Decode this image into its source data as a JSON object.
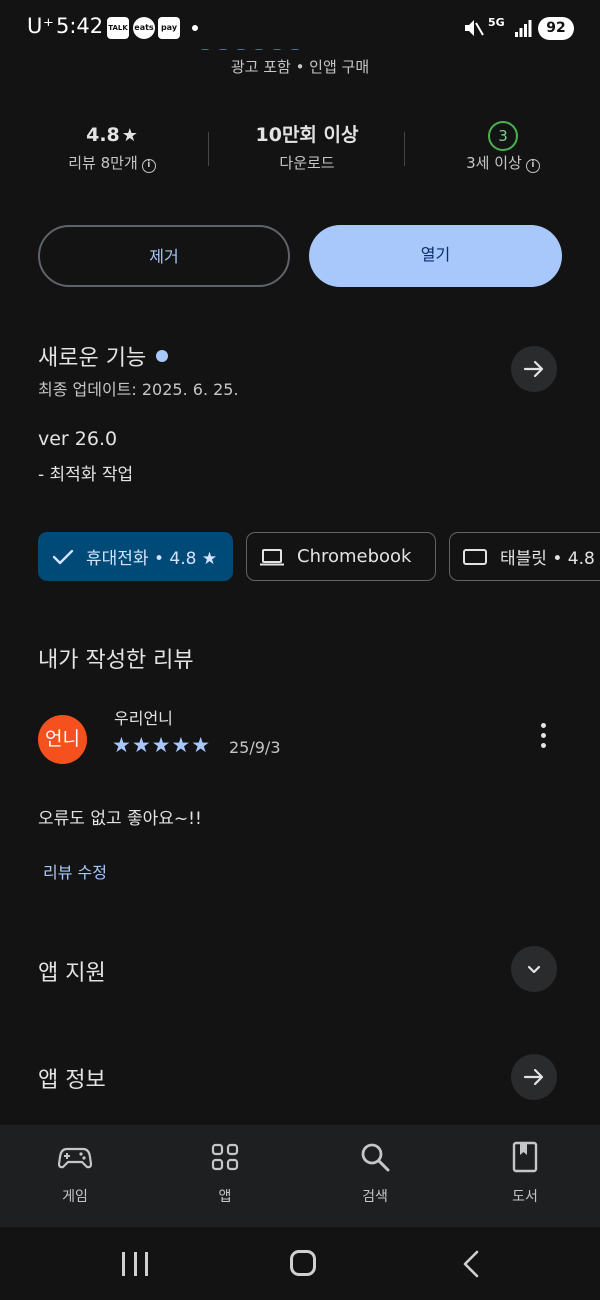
{
  "status_bar": {
    "carrier": "U⁺",
    "time": "5:42",
    "notif_chips": [
      "TALK",
      "eats",
      "pay"
    ],
    "network": "5G",
    "battery": "92"
  },
  "app_header": {
    "subtitle": "광고 포함 • 인앱 구매"
  },
  "stats": {
    "rating_value": "4.8",
    "rating_label": "리뷰 8만개",
    "downloads_value": "10만회 이상",
    "downloads_label": "다운로드",
    "age_value": "3",
    "age_label": "3세 이상"
  },
  "actions": {
    "remove_label": "제거",
    "open_label": "열기"
  },
  "whats_new": {
    "title": "새로운 기능",
    "updated": "최종 업데이트: 2025. 6. 25.",
    "version": "ver 26.0",
    "note": "- 최적화 작업"
  },
  "device_chips": [
    {
      "label": "휴대전화 • 4.8 ★",
      "selected": true
    },
    {
      "label": "Chromebook",
      "selected": false
    },
    {
      "label": "태블릿 • 4.8 ★",
      "selected": false
    }
  ],
  "my_review": {
    "section_title": "내가 작성한 리뷰",
    "avatar_text": "언니",
    "reviewer": "우리언니",
    "stars": "★★★★★",
    "rating": 5,
    "date": "25/9/3",
    "text": "오류도 없고 좋아요~!!",
    "edit_label": "리뷰 수정"
  },
  "sections": {
    "app_support": "앱 지원",
    "app_info": "앱 정보"
  },
  "bottom_nav": {
    "items": [
      {
        "label": "게임",
        "icon": "gamepad-icon"
      },
      {
        "label": "앱",
        "icon": "apps-grid-icon"
      },
      {
        "label": "검색",
        "icon": "search-icon"
      },
      {
        "label": "도서",
        "icon": "book-icon"
      }
    ]
  },
  "colors": {
    "background": "#131314",
    "accent": "#a8c7fa",
    "selected_chip": "#004a77",
    "avatar": "#f4511e",
    "age_badge": "#4caf50"
  }
}
